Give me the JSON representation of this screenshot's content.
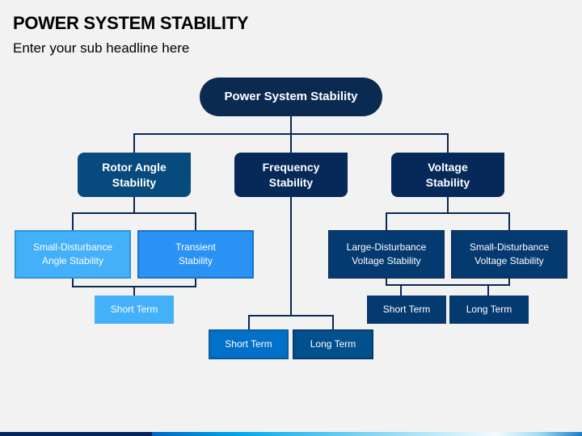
{
  "header": {
    "title": "POWER SYSTEM STABILITY",
    "subtitle": "Enter your sub headline here"
  },
  "diagram": {
    "root": {
      "label": "Power System Stability"
    },
    "categories": [
      {
        "label_line1": "Rotor Angle",
        "label_line2": "Stability",
        "children": [
          {
            "line1": "Small-Disturbance",
            "line2": "Angle Stability"
          },
          {
            "line1": "Transient",
            "line2": "Stability"
          }
        ],
        "terms": [
          "Short Term"
        ]
      },
      {
        "label_line1": "Frequency",
        "label_line2": "Stability",
        "children": [],
        "terms": [
          "Short Term",
          "Long Term"
        ]
      },
      {
        "label_line1": "Voltage",
        "label_line2": "Stability",
        "children": [
          {
            "line1": "Large-Disturbance",
            "line2": "Voltage Stability"
          },
          {
            "line1": "Small-Disturbance",
            "line2": "Voltage Stability"
          }
        ],
        "terms": [
          "Short Term",
          "Long Term"
        ]
      }
    ]
  },
  "colors": {
    "navy": "#0a2a52",
    "rotor_blue": "#064a7e",
    "light_blue": "#44b0fa",
    "mid_blue": "#2b92f5",
    "freq_short": "#0070c8",
    "freq_long": "#03508e",
    "volt_box": "#053a70",
    "background": "#f2f2f2"
  }
}
